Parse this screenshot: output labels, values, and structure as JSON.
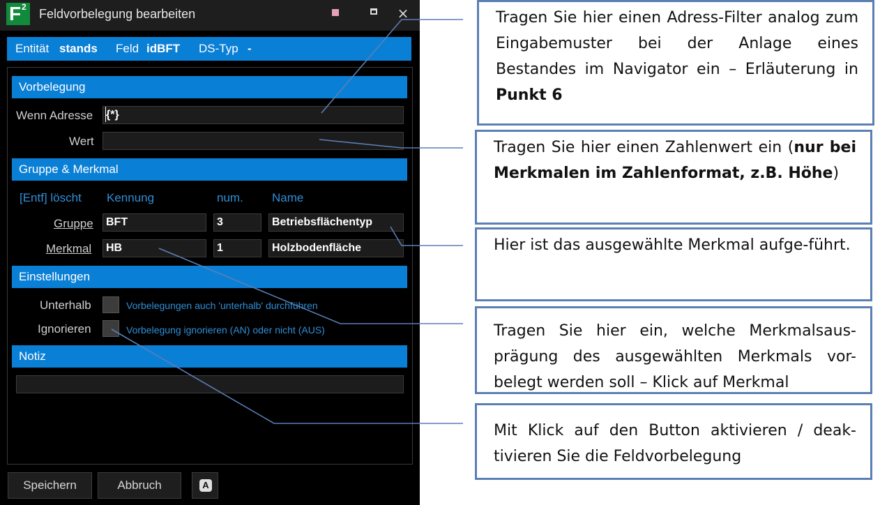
{
  "window": {
    "title": "Feldvorbelegung bearbeiten",
    "logo_text": "F",
    "logo_sup": "2",
    "maximize_icon": "maximize-icon",
    "close_icon": "close-icon",
    "close_glyph": "×"
  },
  "infobar": {
    "entity_label": "Entität",
    "entity_value": "stands",
    "field_label": "Feld",
    "field_value": "idBFT",
    "dstype_label": "DS-Typ",
    "dstype_value": "-"
  },
  "vorbelegung": {
    "header": "Vorbelegung",
    "address_label": "Wenn Adresse",
    "address_value": "{*}",
    "value_label": "Wert",
    "value_value": ""
  },
  "gruppe_merkmal": {
    "header": "Gruppe & Merkmal",
    "col_delete": "[Entf] löscht",
    "col_kennung": "Kennung",
    "col_num": "num.",
    "col_name": "Name",
    "rows": [
      {
        "label": "Gruppe",
        "kennung": "BFT",
        "num": "3",
        "name": "Betriebsflächentyp"
      },
      {
        "label": "Merkmal",
        "kennung": "HB",
        "num": "1",
        "name": "Holzbodenfläche"
      }
    ]
  },
  "einstellungen": {
    "header": "Einstellungen",
    "unterhalb_label": "Unterhalb",
    "unterhalb_desc": "Vorbelegungen auch 'unterhalb' durchführen",
    "ignorieren_label": "Ignorieren",
    "ignorieren_desc": "Vorbelegung ignorieren (AN) oder nicht (AUS)"
  },
  "notiz": {
    "header": "Notiz",
    "value": ""
  },
  "buttons": {
    "save": "Speichern",
    "cancel": "Abbruch",
    "toggle": "A"
  },
  "callouts": {
    "c1_text": "Tragen Sie hier einen Adress-Filter analog zum Eingabemuster bei der Anlage eines Bestandes im Navigator ein – Erläuterung in ",
    "c1_bold": "Punkt 6",
    "c2_text": "Tragen Sie hier einen Zahlenwert ein (",
    "c2_bold": "nur bei Merkmalen im Zahlenformat, z.B. Höhe",
    "c2_end": ")",
    "c3_text": "Hier ist das ausgewählte Merkmal aufge-führt.",
    "c4_text": "Tragen Sie hier ein, welche Merkmalsaus-prägung des ausgewählten Merkmals vor-belegt werden soll – Klick auf Merkmal",
    "c5_text": "Mit Klick auf den Button aktivieren / deak-tivieren Sie die Feldvorbelegung"
  },
  "colors": {
    "accent": "#0a7fd6",
    "background": "#000000",
    "callout_border": "#5b7fb5",
    "logo": "#118a3c"
  }
}
